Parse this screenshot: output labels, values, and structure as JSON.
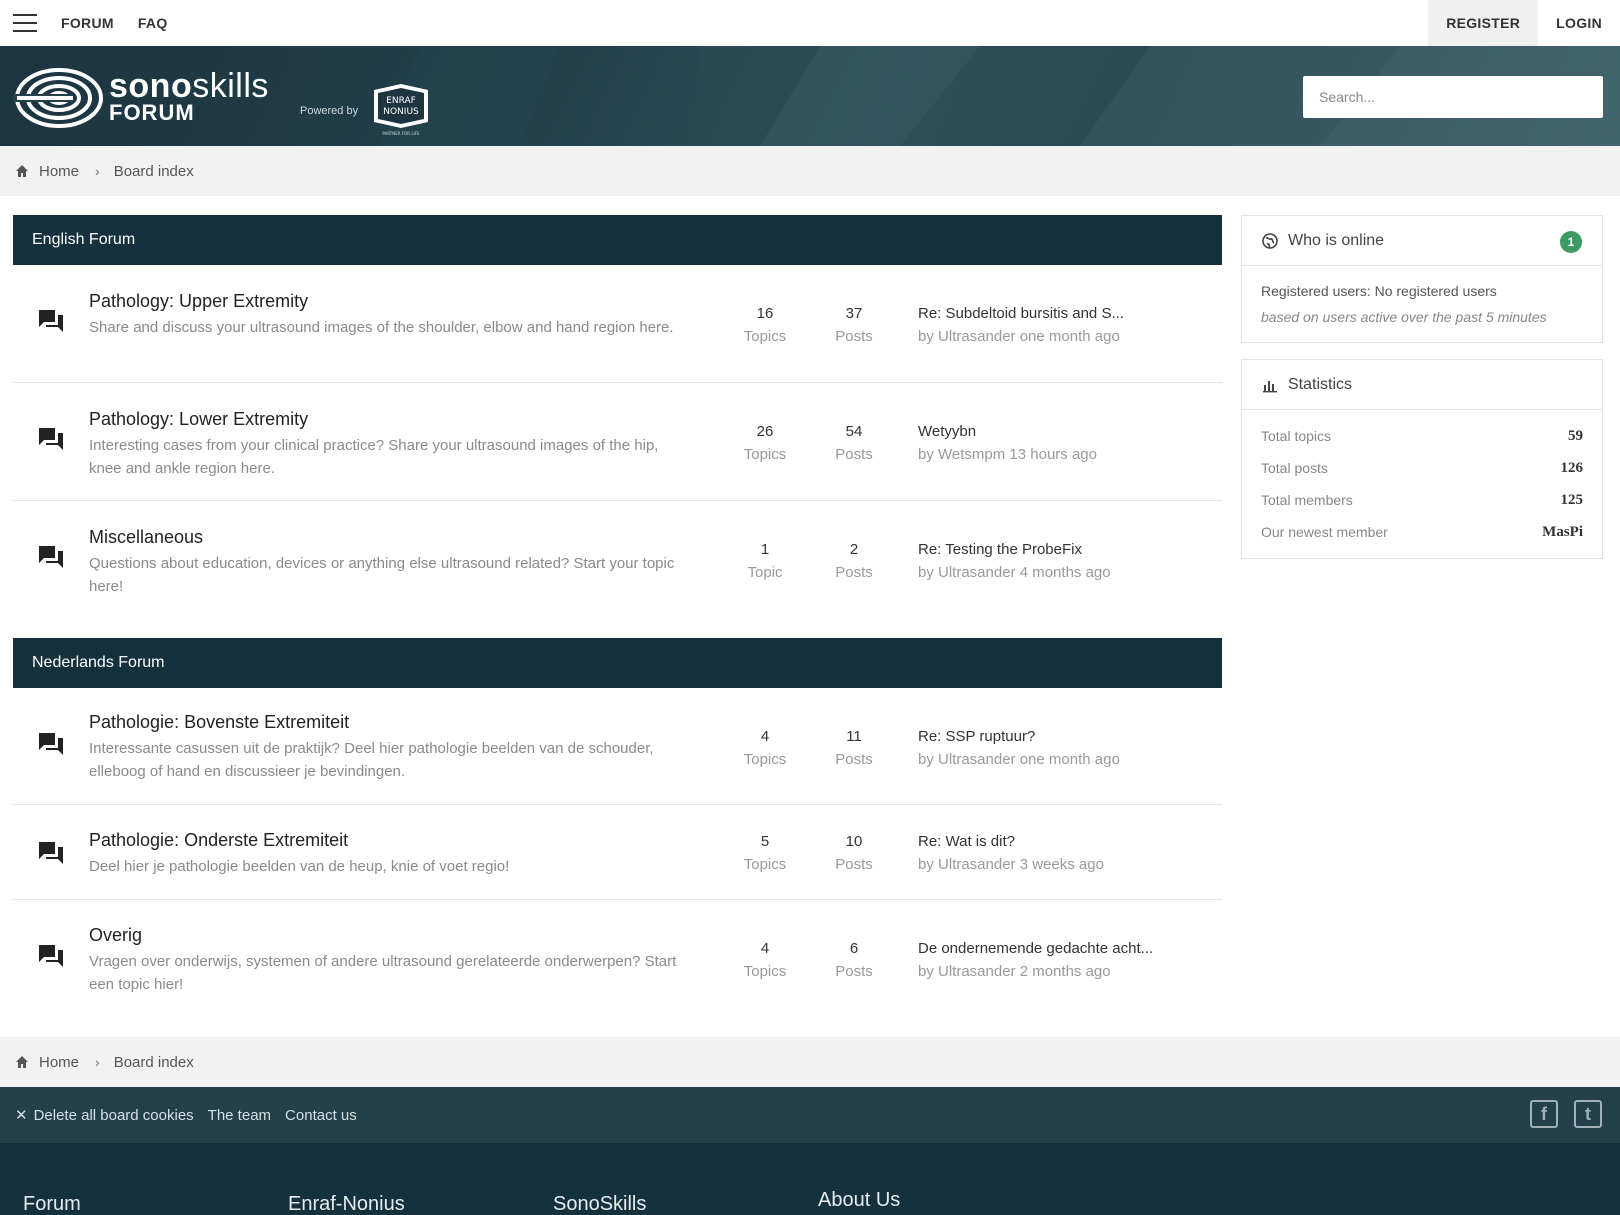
{
  "topnav": {
    "forum": "FORUM",
    "faq": "FAQ",
    "register": "REGISTER",
    "login": "LOGIN"
  },
  "header": {
    "logo_sono": "sono",
    "logo_skills": "skills",
    "logo_forum": "FORUM",
    "powered_by": "Powered by",
    "enraf_line1": "ENRAF",
    "enraf_line2": "NONIUS",
    "enraf_tagline": "PARTNER FOR LIFE",
    "search_placeholder": "Search..."
  },
  "breadcrumb": {
    "home": "Home",
    "board_index": "Board index"
  },
  "sections": [
    {
      "name": "English Forum",
      "forums": [
        {
          "title": "Pathology: Upper Extremity",
          "description": "Share and discuss your ultrasound images of the shoulder, elbow and hand region here.",
          "topics": "16",
          "topics_label": "Topics",
          "posts": "37",
          "posts_label": "Posts",
          "last_title": "Re: Subdeltoid bursitis and S...",
          "last_by": "by Ultrasander one month ago"
        },
        {
          "title": "Pathology: Lower Extremity",
          "description": "Interesting cases from your clinical practice? Share your ultrasound images of the hip, knee and ankle region here.",
          "topics": "26",
          "topics_label": "Topics",
          "posts": "54",
          "posts_label": "Posts",
          "last_title": "Wetyybn",
          "last_by": "by Wetsmpm 13 hours ago"
        },
        {
          "title": "Miscellaneous",
          "description": "Questions about education, devices or anything else ultrasound related? Start your topic here!",
          "topics": "1",
          "topics_label": "Topic",
          "posts": "2",
          "posts_label": "Posts",
          "last_title": "Re: Testing the ProbeFix",
          "last_by": "by Ultrasander 4 months ago"
        }
      ]
    },
    {
      "name": "Nederlands Forum",
      "forums": [
        {
          "title": "Pathologie: Bovenste Extremiteit",
          "description": "Interessante casussen uit de praktijk? Deel hier pathologie beelden van de schouder, elleboog of hand en discussieer je bevindingen.",
          "topics": "4",
          "topics_label": "Topics",
          "posts": "11",
          "posts_label": "Posts",
          "last_title": "Re: SSP ruptuur?",
          "last_by": "by Ultrasander one month ago"
        },
        {
          "title": "Pathologie: Onderste Extremiteit",
          "description": "Deel hier je pathologie beelden van de heup, knie of voet regio!",
          "topics": "5",
          "topics_label": "Topics",
          "posts": "10",
          "posts_label": "Posts",
          "last_title": "Re: Wat is dit?",
          "last_by": "by Ultrasander 3 weeks ago"
        },
        {
          "title": "Overig",
          "description": "Vragen over onderwijs, systemen of andere ultrasound gerelateerde onderwerpen? Start een topic hier!",
          "topics": "4",
          "topics_label": "Topics",
          "posts": "6",
          "posts_label": "Posts",
          "last_title": "De ondernemende gedachte acht...",
          "last_by": "by Ultrasander 2 months ago"
        }
      ]
    }
  ],
  "who_is_online": {
    "title": "Who is online",
    "badge": "1",
    "registered": "Registered users: No registered users",
    "note": "based on users active over the past 5 minutes"
  },
  "statistics": {
    "title": "Statistics",
    "rows": [
      {
        "label": "Total topics",
        "value": "59"
      },
      {
        "label": "Total posts",
        "value": "126"
      },
      {
        "label": "Total members",
        "value": "125"
      },
      {
        "label": "Our newest member",
        "value": "MasPi"
      }
    ]
  },
  "footer": {
    "delete_cookies": "Delete all board cookies",
    "the_team": "The team",
    "contact_us": "Contact us",
    "facebook": "f",
    "twitter": "t",
    "col_forum": "Forum",
    "col_enraf": "Enraf-Nonius",
    "col_sonoskills": "SonoSkills",
    "col_about": "About Us"
  },
  "colors": {
    "section_header": "#15313e",
    "banner": "#23404b",
    "online_badge": "#3d9a63"
  }
}
